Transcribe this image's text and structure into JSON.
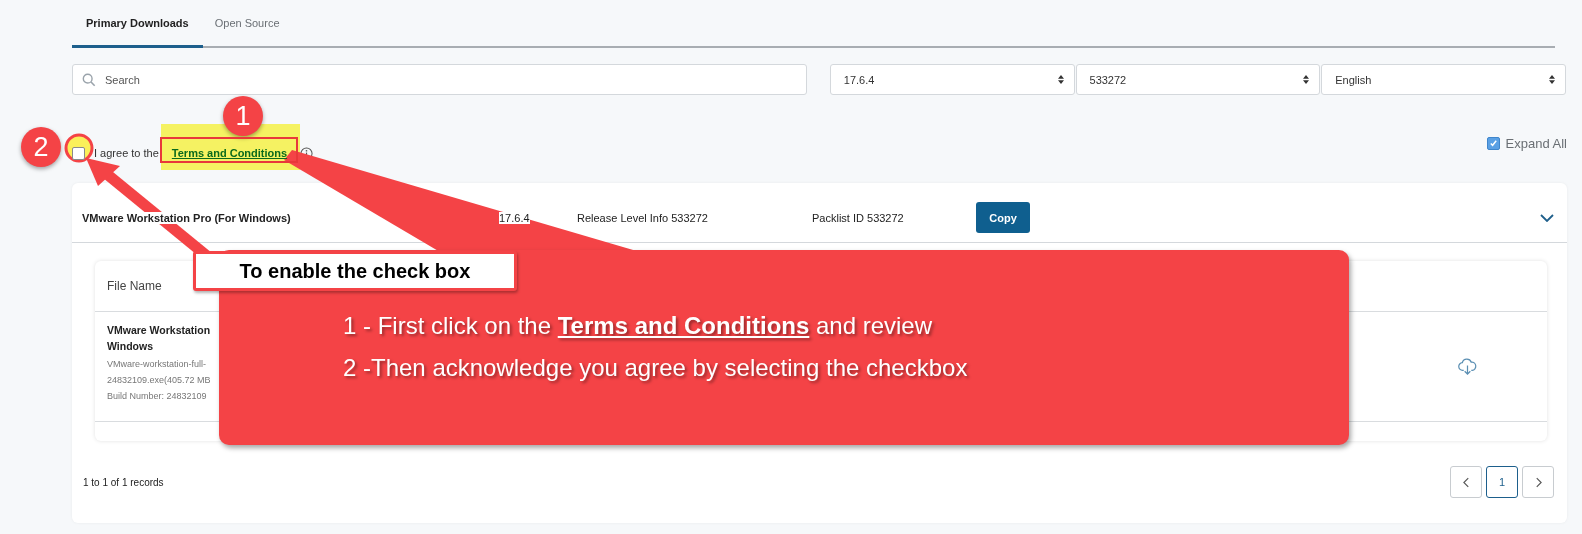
{
  "tabs": [
    {
      "label": "Primary Downloads",
      "selected": true
    },
    {
      "label": "Open Source",
      "selected": false
    }
  ],
  "filters": {
    "search": {
      "placeholder": "Search"
    },
    "selects": [
      "17.6.4",
      "533272",
      "English"
    ]
  },
  "agreement": {
    "checked": false,
    "text": "I agree to the",
    "link": "Terms and Conditions"
  },
  "expand_all": {
    "checked": true,
    "label": "Expand All"
  },
  "product": {
    "name": "VMware Workstation Pro (For Windows)",
    "version": "17.6.4",
    "release": "Release Level Info 533272",
    "packlist": "Packlist ID 533272",
    "copy": "Copy",
    "expanded": true,
    "files": {
      "column": "File Name",
      "rows": [
        {
          "name": [
            "VMware Workstation",
            "Windows"
          ],
          "details": [
            "VMware-workstation-full-",
            "24832109.exe(405.72 MB",
            "Build Number: 24832109"
          ]
        }
      ]
    }
  },
  "footer": {
    "records": "1 to 1 of 1 records",
    "pages": [
      {
        "label": "1",
        "selected": true
      }
    ]
  },
  "annotations": {
    "badges": [
      "1",
      "2"
    ],
    "callout": "To enable the check box",
    "instructions": [
      "1 - First click on the **Terms and Conditions** and review",
      "2 -Then acknowledge you agree by selecting the checkbox"
    ]
  }
}
